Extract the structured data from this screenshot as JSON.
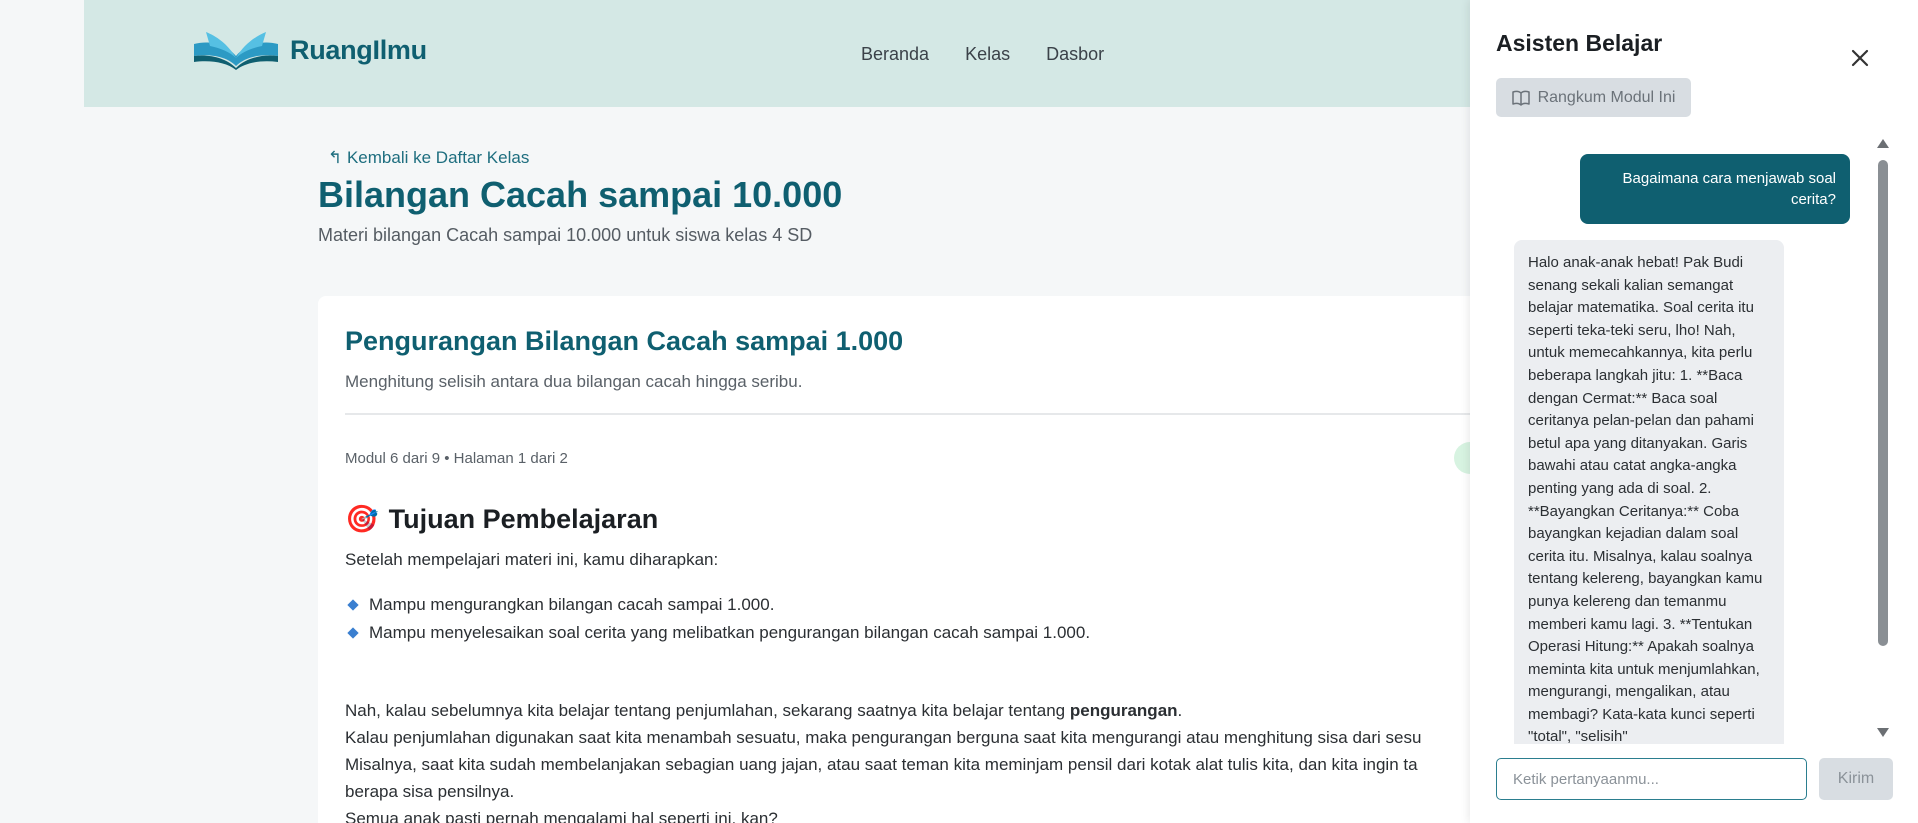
{
  "header": {
    "brand": "RuangIlmu",
    "logo_icon": "open-book-icon",
    "nav": [
      {
        "label": "Beranda"
      },
      {
        "label": "Kelas"
      },
      {
        "label": "Dasbor"
      }
    ]
  },
  "main": {
    "back_link": "↰ Kembali ke Daftar Kelas",
    "title": "Bilangan Cacah sampai 10.000",
    "subtitle": "Materi bilangan Cacah sampai 10.000 untuk siswa kelas 4 SD",
    "card": {
      "title": "Pengurangan Bilangan Cacah sampai 1.000",
      "subtitle": "Menghitung selisih antara dua bilangan cacah hingga seribu.",
      "meta": "Modul 6 dari 9 • Halaman 1 dari 2",
      "section_icon": "🎯",
      "section_title": "Tujuan Pembelajaran",
      "intro": "Setelah mempelajari materi ini, kamu diharapkan:",
      "objectives": [
        "Mampu mengurangkan bilangan cacah sampai 1.000.",
        "Mampu menyelesaikan soal cerita yang melibatkan pengurangan bilangan cacah sampai 1.000."
      ],
      "para1_before": "Nah, kalau sebelumnya kita belajar tentang penjumlahan, sekarang saatnya kita belajar tentang ",
      "para1_bold": "pengurangan",
      "para1_after": ".",
      "para2": "Kalau penjumlahan digunakan saat kita menambah sesuatu, maka pengurangan berguna saat kita mengurangi atau menghitung sisa dari sesu",
      "para3": "Misalnya, saat kita sudah membelanjakan sebagian uang jajan, atau saat teman kita meminjam pensil dari kotak alat tulis kita, dan kita ingin ta",
      "para4": "berapa sisa pensilnya.",
      "para5": "Semua anak pasti pernah mengalami hal seperti ini, kan?"
    }
  },
  "assistant": {
    "title": "Asisten Belajar",
    "summary_button": "Rangkum Modul Ini",
    "user_message": "Bagaimana cara menjawab soal cerita?",
    "bot_message": "Halo anak-anak hebat! Pak Budi senang sekali kalian semangat belajar matematika. Soal cerita itu seperti teka-teki seru, lho! Nah, untuk memecahkannya, kita perlu beberapa langkah jitu: 1. **Baca dengan Cermat:** Baca soal ceritanya pelan-pelan dan pahami betul apa yang ditanyakan. Garis bawahi atau catat angka-angka penting yang ada di soal. 2. **Bayangkan Ceritanya:** Coba bayangkan kejadian dalam soal cerita itu. Misalnya, kalau soalnya tentang kelereng, bayangkan kamu punya kelereng dan temanmu memberi kamu lagi. 3. **Tentukan Operasi Hitung:** Apakah soalnya meminta kita untuk menjumlahkan, mengurangi, mengalikan, atau membagi? Kata-kata kunci seperti \"total\", \"selisih\"",
    "input_placeholder": "Ketik pertanyaanmu...",
    "send_label": "Kirim"
  },
  "colors": {
    "brand": "#0f5f70",
    "header_bg": "#d4e8e5",
    "user_bubble": "#0f5f70",
    "bot_bubble": "#eceef1"
  }
}
